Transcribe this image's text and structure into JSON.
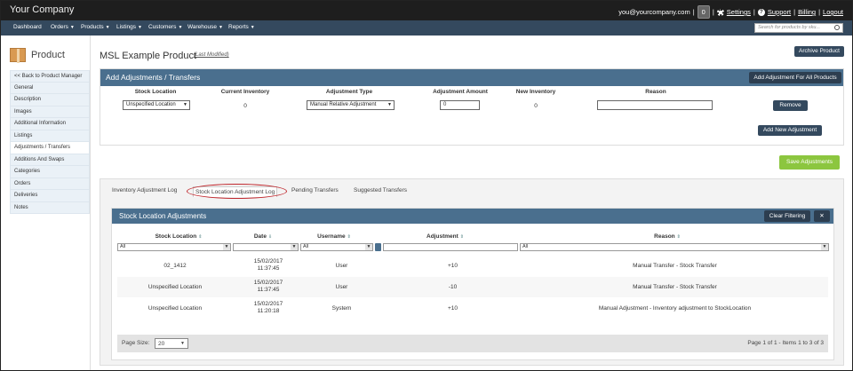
{
  "topbar": {
    "company": "Your Company",
    "email": "you@yourcompany.com",
    "sep1": "|",
    "badge": "0",
    "sep2": "|",
    "settings": "Settings",
    "sep3": "|",
    "support": "Support",
    "sep4": "|",
    "billing": "Billing",
    "sep5": "|",
    "logout": "Logout"
  },
  "nav": {
    "items": [
      "Dashboard",
      "Orders",
      "Products",
      "Listings",
      "Customers",
      "Warehouse",
      "Reports"
    ],
    "caret": "▼",
    "search_placeholder": "Search for products by sku..."
  },
  "sidebar": {
    "title": "Product",
    "items": [
      "<< Back to Product Manager",
      "General",
      "Description",
      "Images",
      "Additional Information",
      "Listings",
      "Adjustments / Transfers",
      "Additions And Swaps",
      "Categories",
      "Orders",
      "Deliveries",
      "Notes"
    ]
  },
  "main": {
    "title": "MSL Example Product",
    "last_modified": "(Last Modified)",
    "archive_btn": "Archive Product",
    "save_btn": "Save Adjustments"
  },
  "adjust": {
    "title": "Add Adjustments / Transfers",
    "add_all_btn": "Add Adjustment For All Products",
    "columns": [
      "Stock Location",
      "Current Inventory",
      "Adjustment Type",
      "Adjustment Amount",
      "New Inventory",
      "Reason"
    ],
    "row": {
      "location": "Unspecified Location",
      "current": "0",
      "type": "Manual Relative Adjustment",
      "amount": "0",
      "new_inv": "0",
      "reason": ""
    },
    "remove_btn": "Remove",
    "add_new_btn": "Add New Adjustment"
  },
  "tabs": [
    "Inventory Adjustment Log",
    "Stock Location Adjustment Log",
    "Pending Transfers",
    "Suggested Transfers"
  ],
  "grid": {
    "title": "Stock Location Adjustments",
    "clear_btn": "Clear Filtering",
    "columns": [
      "Stock Location",
      "Date",
      "Username",
      "Adjustment",
      "Reason"
    ],
    "sort_icon": "⇕",
    "sort_desc": "⇓",
    "filters": [
      "All",
      "",
      "All",
      "",
      "All"
    ],
    "rows": [
      {
        "location": "02_1412",
        "date": "15/02/2017",
        "time": "11:37:45",
        "user": "User",
        "adj": "+10",
        "reason": "Manual Transfer - Stock Transfer"
      },
      {
        "location": "Unspecified Location",
        "date": "15/02/2017",
        "time": "11:37:45",
        "user": "User",
        "adj": "-10",
        "reason": "Manual Transfer - Stock Transfer"
      },
      {
        "location": "Unspecified Location",
        "date": "15/02/2017",
        "time": "11:20:18",
        "user": "System",
        "adj": "+10",
        "reason": "Manual Adjustment - Inventory adjustment to StockLocation"
      }
    ],
    "page_size_label": "Page Size:",
    "page_size": "20",
    "page_info": "Page 1 of 1 - Items 1 to 3 of 3"
  }
}
